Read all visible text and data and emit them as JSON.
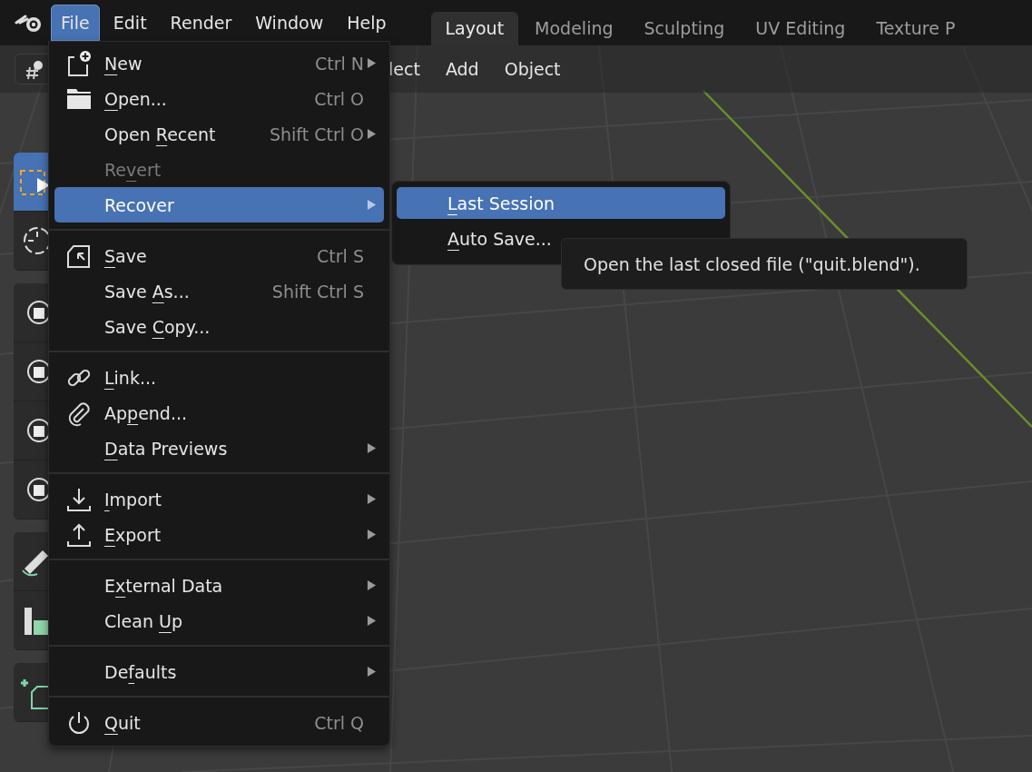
{
  "top_menu": [
    {
      "label": "File",
      "selected": true
    },
    {
      "label": "Edit",
      "selected": false
    },
    {
      "label": "Render",
      "selected": false
    },
    {
      "label": "Window",
      "selected": false
    },
    {
      "label": "Help",
      "selected": false
    }
  ],
  "workspace_tabs": [
    {
      "label": "Layout",
      "selected": true
    },
    {
      "label": "Modeling",
      "selected": false
    },
    {
      "label": "Sculpting",
      "selected": false
    },
    {
      "label": "UV Editing",
      "selected": false
    },
    {
      "label": "Texture P",
      "selected": false
    }
  ],
  "viewport_header": {
    "menus": [
      "lect",
      "Add",
      "Object"
    ]
  },
  "file_menu": [
    {
      "kind": "item",
      "label": "New",
      "shortcut": "Ctrl N",
      "submenu": true,
      "disabled": false,
      "selected": false
    },
    {
      "kind": "item",
      "label": "Open...",
      "shortcut": "Ctrl O",
      "submenu": false,
      "disabled": false,
      "selected": false
    },
    {
      "kind": "item",
      "label": "Open Recent",
      "shortcut": "Shift Ctrl O",
      "submenu": true,
      "disabled": false,
      "selected": false
    },
    {
      "kind": "item",
      "label": "Revert",
      "submenu": false,
      "disabled": true,
      "selected": false
    },
    {
      "kind": "item",
      "label": "Recover",
      "submenu": true,
      "disabled": false,
      "selected": true
    },
    {
      "kind": "separator"
    },
    {
      "kind": "item",
      "label": "Save",
      "shortcut": "Ctrl S",
      "submenu": false,
      "disabled": false,
      "selected": false
    },
    {
      "kind": "item",
      "label": "Save As...",
      "shortcut": "Shift Ctrl S",
      "submenu": false,
      "disabled": false,
      "selected": false
    },
    {
      "kind": "item",
      "label": "Save Copy...",
      "submenu": false,
      "disabled": false,
      "selected": false
    },
    {
      "kind": "separator"
    },
    {
      "kind": "item",
      "label": "Link...",
      "submenu": false,
      "disabled": false,
      "selected": false
    },
    {
      "kind": "item",
      "label": "Append...",
      "submenu": false,
      "disabled": false,
      "selected": false
    },
    {
      "kind": "item",
      "label": "Data Previews",
      "submenu": true,
      "disabled": false,
      "selected": false
    },
    {
      "kind": "separator"
    },
    {
      "kind": "item",
      "label": "Import",
      "submenu": true,
      "disabled": false,
      "selected": false
    },
    {
      "kind": "item",
      "label": "Export",
      "submenu": true,
      "disabled": false,
      "selected": false
    },
    {
      "kind": "separator"
    },
    {
      "kind": "item",
      "label": "External Data",
      "submenu": true,
      "disabled": false,
      "selected": false
    },
    {
      "kind": "item",
      "label": "Clean Up",
      "submenu": true,
      "disabled": false,
      "selected": false
    },
    {
      "kind": "separator"
    },
    {
      "kind": "item",
      "label": "Defaults",
      "submenu": true,
      "disabled": false,
      "selected": false
    },
    {
      "kind": "separator"
    },
    {
      "kind": "item",
      "label": "Quit",
      "shortcut": "Ctrl Q",
      "submenu": false,
      "disabled": false,
      "selected": false
    }
  ],
  "recover_submenu": [
    {
      "label": "Last Session",
      "selected": true
    },
    {
      "label": "Auto Save...",
      "selected": false
    }
  ],
  "tooltip": "Open the last closed file (\"quit.blend\")."
}
